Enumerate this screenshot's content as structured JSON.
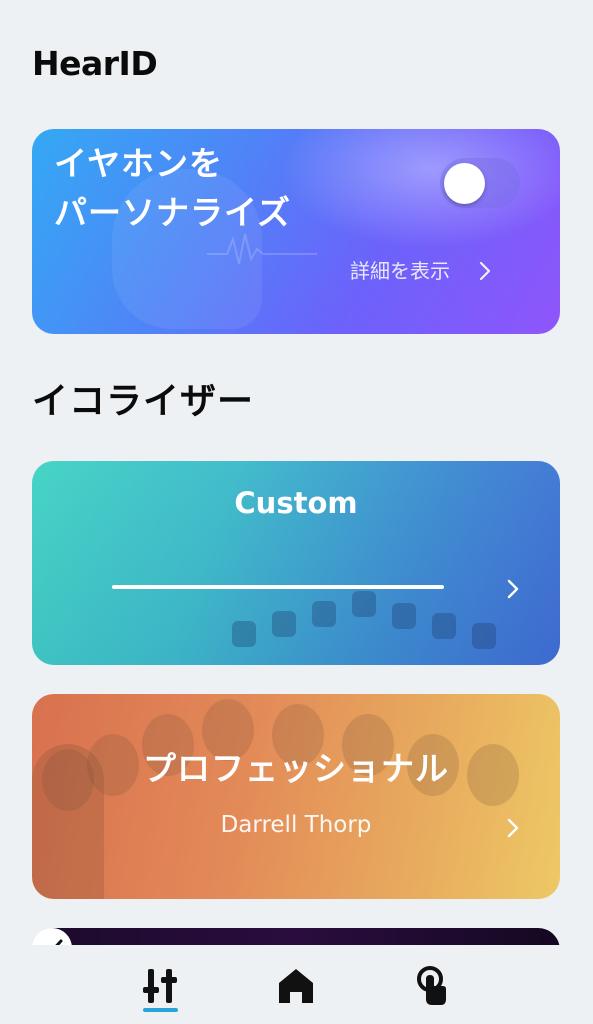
{
  "hearid": {
    "title": "HearID",
    "card": {
      "heading_line1": "イヤホンを",
      "heading_line2": "パーソナライズ",
      "toggle_state": "off",
      "details_label": "詳細を表示"
    }
  },
  "equalizer": {
    "title": "イコライザー",
    "presets": [
      {
        "title": "Custom",
        "subtitle": ""
      },
      {
        "title": "プロフェッショナル",
        "subtitle": "Darrell Thorp"
      }
    ]
  },
  "tabbar": {
    "tabs": [
      {
        "icon": "sliders-icon",
        "active": true
      },
      {
        "icon": "home-icon",
        "active": false
      },
      {
        "icon": "touch-gesture-icon",
        "active": false
      }
    ]
  }
}
